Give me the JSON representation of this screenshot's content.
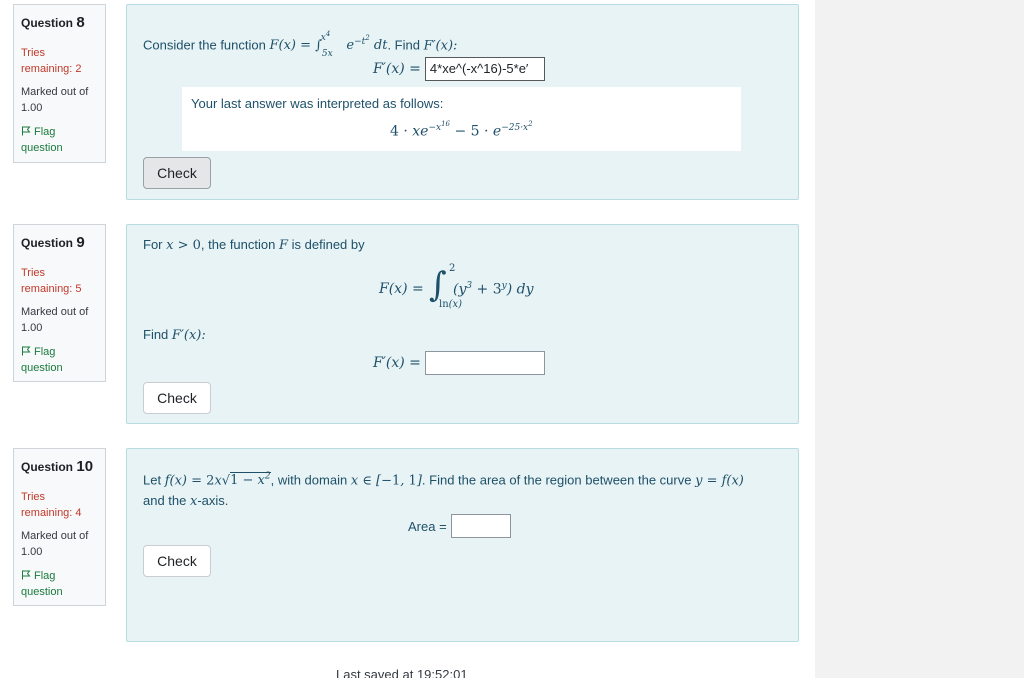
{
  "questions": [
    {
      "label": "Question",
      "number": "8",
      "tries": "Tries remaining: 2",
      "marked": "Marked out of 1.00",
      "flag": "Flag question",
      "prompt_prefix": "Consider the function",
      "prompt_find": ". Find",
      "answer_label": "F′(x) =",
      "answer_value": "4*xe^(-x^16)-5*e′",
      "feedback_title": "Your last answer was interpreted as follows:",
      "check_label": "Check"
    },
    {
      "label": "Question",
      "number": "9",
      "tries": "Tries remaining: 5",
      "marked": "Marked out of 1.00",
      "flag": "Flag question",
      "prompt_for": "For",
      "prompt_defined": ", the function",
      "prompt_defined2": "is defined by",
      "find_text": "Find",
      "answer_label": "F′(x) =",
      "answer_value": "",
      "check_label": "Check"
    },
    {
      "label": "Question",
      "number": "10",
      "tries": "Tries remaining: 4",
      "marked": "Marked out of 1.00",
      "flag": "Flag question",
      "prompt_let": "Let",
      "prompt_with": ", with domain",
      "prompt_find": ". Find the area of the region between the curve",
      "prompt_and": "and the",
      "prompt_axis": "-axis.",
      "answer_label": "Area =",
      "answer_value": "",
      "check_label": "Check"
    }
  ],
  "footer": "Last saved at 19:52:01",
  "colors": {
    "tries": "#c0392b",
    "flag": "#1a7a3e",
    "content_bg": "#e7f3f5",
    "math": "#1f5069"
  }
}
